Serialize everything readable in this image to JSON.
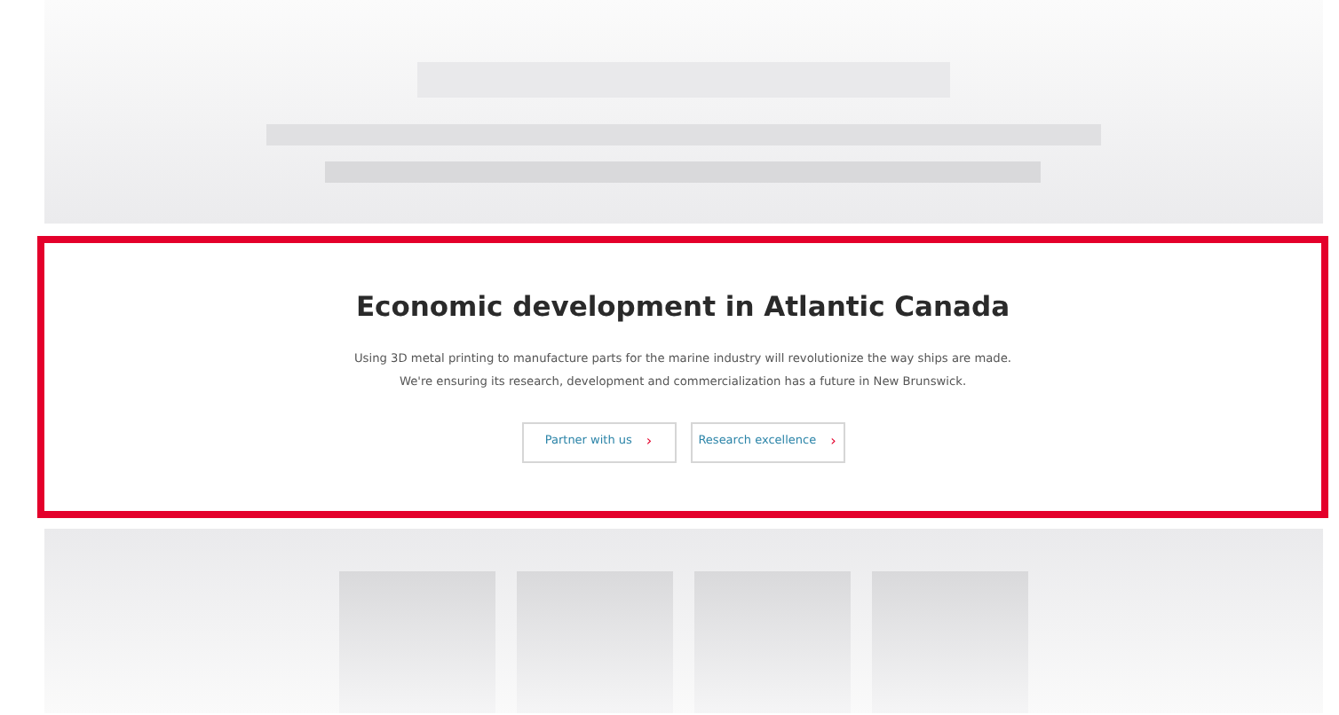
{
  "section": {
    "heading": "Economic development in Atlantic Canada",
    "description_lines": [
      "Using 3D metal printing to manufacture parts for the marine industry will revolutionize the way ships are made.",
      "We're ensuring its research, development and commercialization has a future in New Brunswick."
    ],
    "buttons": [
      {
        "label": "Partner with us",
        "chevron": "›"
      },
      {
        "label": "Research excellence",
        "chevron": "›"
      }
    ]
  }
}
